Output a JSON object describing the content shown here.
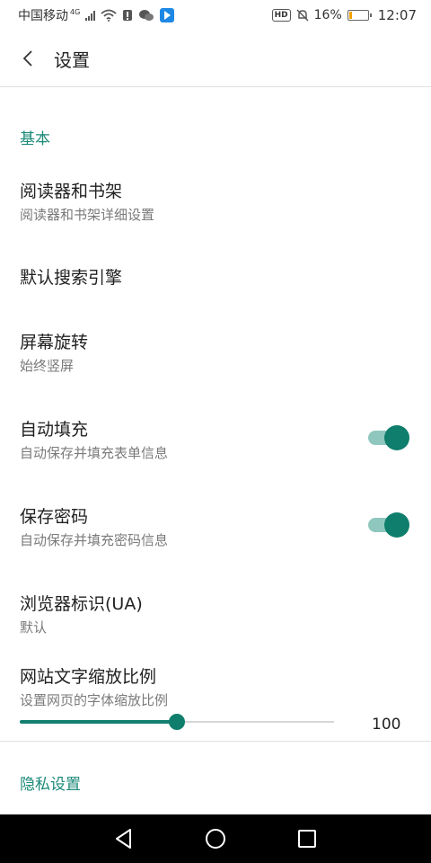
{
  "status_bar": {
    "carrier": "中国移动",
    "network": "4G",
    "icons": [
      "signal-icon",
      "wifi-icon",
      "alert-icon",
      "wechat-icon",
      "app-icon",
      "hd-icon",
      "mute-icon",
      "battery-icon"
    ],
    "hd": "HD",
    "battery_percent": "16%",
    "battery_level": 0.16,
    "time": "12:07"
  },
  "toolbar": {
    "title": "设置"
  },
  "sections": {
    "basic": "基本",
    "privacy": "隐私设置"
  },
  "items": {
    "reader": {
      "title": "阅读器和书架",
      "subtitle": "阅读器和书架详细设置"
    },
    "search_engine": {
      "title": "默认搜索引擎"
    },
    "rotation": {
      "title": "屏幕旋转",
      "subtitle": "始终竖屏"
    },
    "autofill": {
      "title": "自动填充",
      "subtitle": "自动保存并填充表单信息",
      "enabled": true
    },
    "save_password": {
      "title": "保存密码",
      "subtitle": "自动保存并填充密码信息",
      "enabled": true
    },
    "user_agent": {
      "title": "浏览器标识(UA)",
      "subtitle": "默认"
    },
    "text_zoom": {
      "title": "网站文字缩放比例",
      "subtitle": "设置网页的字体缩放比例",
      "value": "100",
      "slider_fraction": 0.5
    }
  },
  "colors": {
    "accent": "#0f7e6c",
    "accent_light": "#8fc7be",
    "section_header": "#1b8a78"
  }
}
